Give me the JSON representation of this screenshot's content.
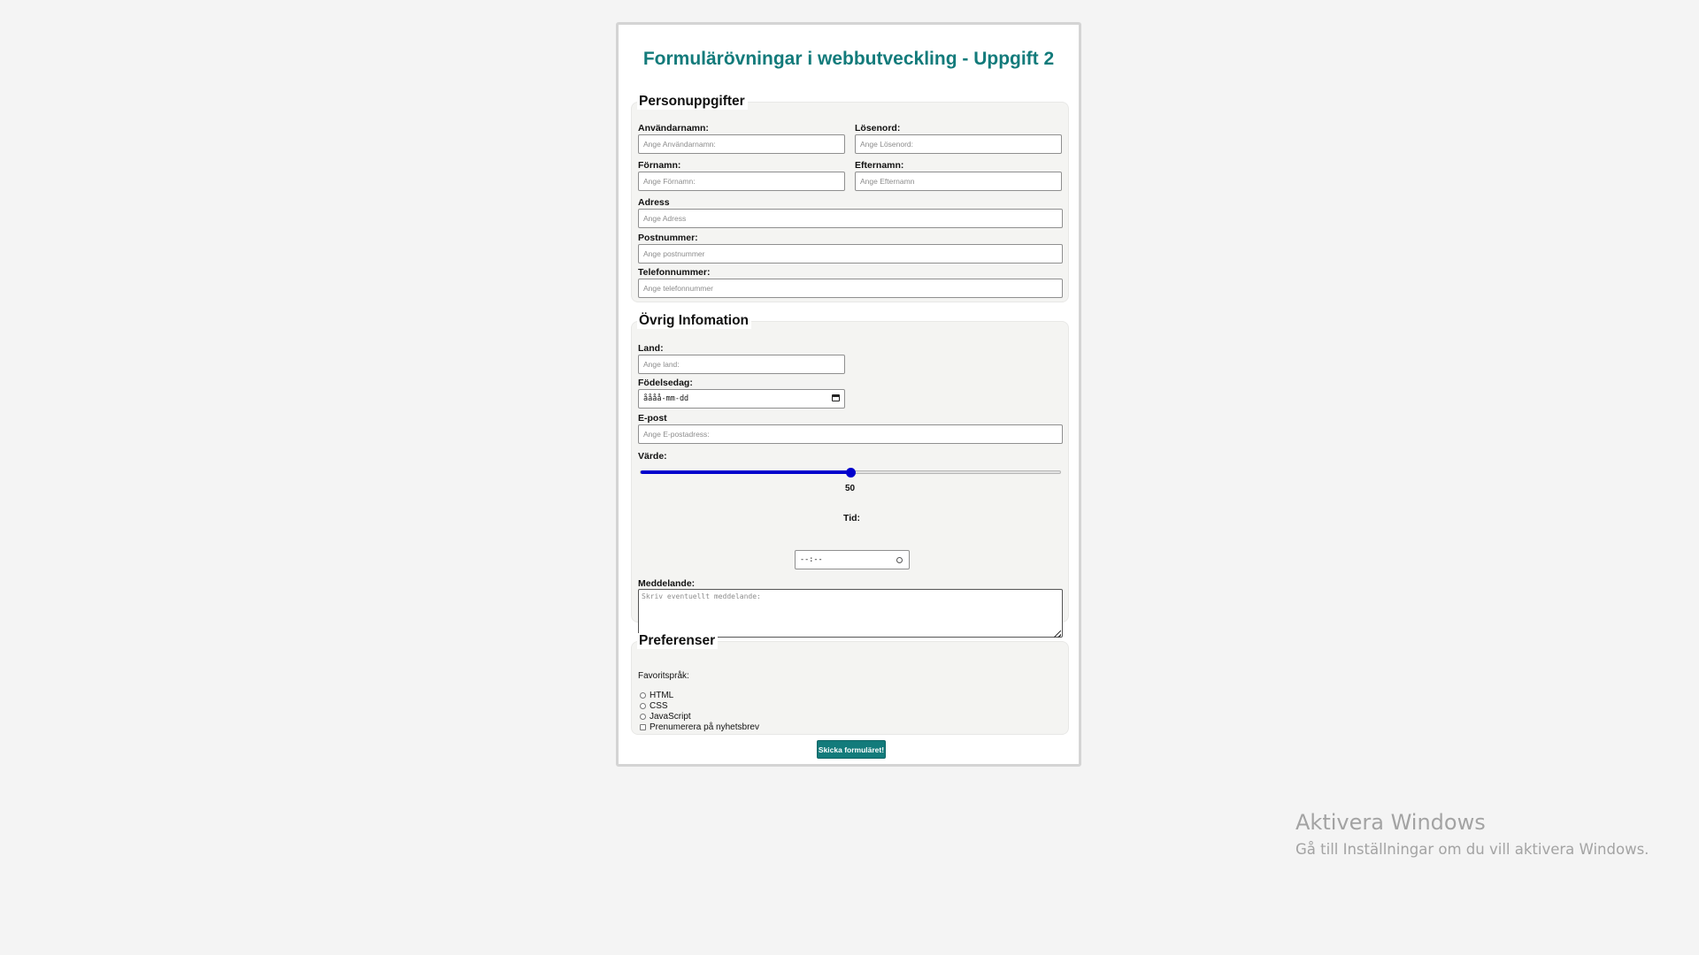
{
  "page": {
    "title": "Formulärövningar i webbutveckling - Uppgift 2",
    "submit_label": "Skicka formuläret!"
  },
  "personal": {
    "legend": "Personuppgifter",
    "username": {
      "label": "Användarnamn:",
      "placeholder": "Ange Användarnamn:"
    },
    "password": {
      "label": "Lösenord:",
      "placeholder": "Ange Lösenord:"
    },
    "firstname": {
      "label": "Förnamn:",
      "placeholder": "Ange Förnamn:"
    },
    "lastname": {
      "label": "Efternamn:",
      "placeholder": "Ange Efternamn"
    },
    "address": {
      "label": "Adress",
      "placeholder": "Ange Adress"
    },
    "postcode": {
      "label": "Postnummer:",
      "placeholder": "Ange postnummer"
    },
    "phone": {
      "label": "Telefonnummer:",
      "placeholder": "Ange telefonnummer"
    }
  },
  "other": {
    "legend": "Övrig Infomation",
    "country": {
      "label": "Land:",
      "placeholder": "Ange land:"
    },
    "birthday": {
      "label": "Födelsedag:",
      "value": "åååå-mm-dd"
    },
    "email": {
      "label": "E-post",
      "placeholder": "Ange E-postadress:"
    },
    "value": {
      "label": "Värde:",
      "current": 50,
      "min": 0,
      "max": 100,
      "display": "50",
      "accent_color": "#0000cc"
    },
    "time": {
      "label": "Tid:",
      "value": "--:--"
    },
    "message": {
      "label": "Meddelande:",
      "placeholder": "Skriv eventuellt meddelande:"
    }
  },
  "preferences": {
    "legend": "Preferenser",
    "favorite_label": "Favoritspråk:",
    "options": [
      "HTML",
      "CSS",
      "JavaScript"
    ],
    "newsletter_label": "Prenumerera på nyhetsbrev"
  },
  "watermark": {
    "title": "Aktivera Windows",
    "subtitle": "Gå till Inställningar om du vill aktivera Windows."
  },
  "colors": {
    "accent": "#137b7b",
    "slider": "#0000cc",
    "background": "#f4f4f4"
  }
}
